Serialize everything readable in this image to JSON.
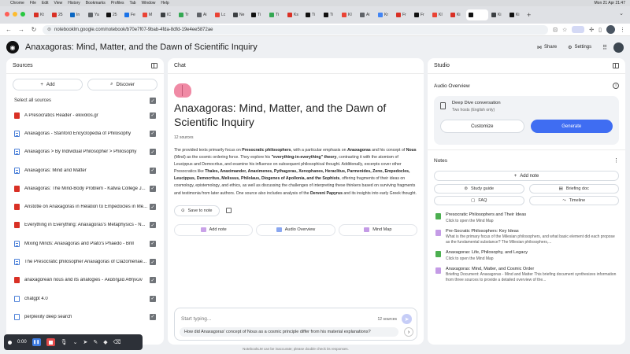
{
  "menubar": {
    "items": [
      "Chrome",
      "File",
      "Edit",
      "View",
      "History",
      "Bookmarks",
      "Profiles",
      "Tab",
      "Window",
      "Help"
    ],
    "clock": "Mon 21 Apr 21:47"
  },
  "tabs": [
    {
      "label": "Kt",
      "color": "#d93025"
    },
    {
      "label": "25",
      "color": "#d93025"
    },
    {
      "label": "In",
      "color": "#0a66c2"
    },
    {
      "label": "Ya",
      "color": "#5f6368"
    },
    {
      "label": "25",
      "color": "#111111"
    },
    {
      "label": "Fe",
      "color": "#1a73e8"
    },
    {
      "label": "M",
      "color": "#ea4335"
    },
    {
      "label": "IC",
      "color": "#3c4043"
    },
    {
      "label": "Tr",
      "color": "#34a853"
    },
    {
      "label": "Ai",
      "color": "#5f6368"
    },
    {
      "label": "Lc",
      "color": "#ea4335"
    },
    {
      "label": "Ne",
      "color": "#3c4043"
    },
    {
      "label": "Ti",
      "color": "#111111"
    },
    {
      "label": "Ti",
      "color": "#34a853"
    },
    {
      "label": "Ks",
      "color": "#d93025"
    },
    {
      "label": "Ti",
      "color": "#111111"
    },
    {
      "label": "Ti",
      "color": "#111111"
    },
    {
      "label": "KI",
      "color": "#ea4335"
    },
    {
      "label": "Ai",
      "color": "#5f6368"
    },
    {
      "label": "Kr",
      "color": "#4285f4"
    },
    {
      "label": "Fr",
      "color": "#d93025"
    },
    {
      "label": "Fr",
      "color": "#111111"
    },
    {
      "label": "KI",
      "color": "#ea4335"
    },
    {
      "label": "Ki",
      "color": "#d93025"
    },
    {
      "label": "",
      "color": "#111111",
      "active": true
    },
    {
      "label": "Ki",
      "color": "#3c4043"
    },
    {
      "label": "Ki",
      "color": "#111111"
    }
  ],
  "address": {
    "url": "notebooklm.google.com/notebook/b70e7f07-9bab-4fda-8dfd-19e4ee5872ae"
  },
  "header": {
    "title": "Anaxagoras: Mind, Matter, and the Dawn of Scientific Inquiry",
    "share": "Share",
    "settings": "Settings"
  },
  "sources": {
    "heading": "Sources",
    "add": "Add",
    "discover": "Discover",
    "select_all": "Select all sources",
    "items": [
      {
        "label": "A Presocratics Reader - ekivolos.gr",
        "type": "pdf"
      },
      {
        "label": "Anaxagoras - Stanford Encyclopedia of Philosophy",
        "type": "web"
      },
      {
        "label": "Anaxagoras > By Individual Philosopher > Philosophy",
        "type": "web"
      },
      {
        "label": "Anaxagoras: Mind and Matter",
        "type": "web"
      },
      {
        "label": "Anaxagoras: The Mind-Body Problem - Katwa College J...",
        "type": "pdf"
      },
      {
        "label": "Aristotle on Anaxagoras in Relation to Empedocles in Me...",
        "type": "pdf"
      },
      {
        "label": "Everything in Everything: Anaxagoras's Metaphysics - N...",
        "type": "pdf"
      },
      {
        "label": "Mixing Minds: Anaxagoras and Plato's Phaedo - Brill",
        "type": "web"
      },
      {
        "label": "The Presocratic philosopher Anaxagoras of Clazomenae...",
        "type": "web"
      },
      {
        "label": "anaxagorean nous and its analogies - Ακαδημία Αθηνών",
        "type": "pdf"
      },
      {
        "label": "chatgpt 4.0",
        "type": "txt"
      },
      {
        "label": "perplexity deep search",
        "type": "txt"
      }
    ]
  },
  "chat": {
    "heading": "Chat",
    "title": "Anaxagoras: Mind, Matter, and the Dawn of Scientific Inquiry",
    "count": "12 sources",
    "summary": {
      "t1": "The provided texts primarily focus on ",
      "b1": "Presocratic philosophers",
      "t2": ", with a particular emphasis on ",
      "b2": "Anaxagoras",
      "t3": " and his concept of ",
      "b3": "Nous",
      "t4": " (Mind) as the cosmic ordering force. They explore his ",
      "b4": "\"everything-in-everything\" theory",
      "t5": ", contrasting it with the atomism of Leucippus and Democritus, and examine his influence on subsequent philosophical thought. Additionally, excerpts cover other Presocratics like ",
      "b5": "Thales, Anaximander, Anaximenes, Pythagoras, Xenophanes, Heraclitus, Parmenides, Zeno, Empedocles, Leucippus, Democritus, Melissus, Philolaus, Diogenes of Apollonia, and the Sophists",
      "t6": ", offering fragments of their ideas on cosmology, epistemology, and ethics, as well as discussing the challenges of interpreting these thinkers based on surviving fragments and testimonia from later authors. One source also includes analysis of the ",
      "b6": "Derveni Papyrus",
      "t7": " and its insights into early Greek thought."
    },
    "save_note": "Save to note",
    "chips": [
      {
        "label": "Add note",
        "color": "#c9a2e8"
      },
      {
        "label": "Audio Overview",
        "color": "#8aa7f0"
      },
      {
        "label": "Mind Map",
        "color": "#c49be6"
      }
    ],
    "input_placeholder": "Start typing...",
    "input_count": "12 sources",
    "suggestion": "How did Anaxagoras' concept of Nous as a cosmic principle differ from his material explanations?"
  },
  "studio": {
    "heading": "Studio",
    "audio_overview": "Audio Overview",
    "deep_dive": "Deep Dive conversation",
    "hosts": "Two hosts (English only)",
    "customize": "Customize",
    "generate": "Generate",
    "notes": "Notes",
    "add_note": "Add note",
    "study_guide": "Study guide",
    "briefing_doc": "Briefing doc",
    "faq": "FAQ",
    "timeline": "Timeline",
    "note_items": [
      {
        "title": "Presocratic Philosophers and Their Ideas",
        "sub": "Click to open the Mind Map",
        "color": "#4caf50"
      },
      {
        "title": "Pre-Socratic Philosophers: Key Ideas",
        "sub": "What is the primary focus of the Milesian philosophers, and what basic element did each propose as the fundamental substance? The Milesian philosophers,...",
        "color": "#c49be6"
      },
      {
        "title": "Anaxagoras: Life, Philosophy, and Legacy",
        "sub": "Click to open the Mind Map",
        "color": "#4caf50"
      },
      {
        "title": "Anaxagoras: Mind, Matter, and Cosmic Order",
        "sub": "Briefing Document: Anaxagoras - Mind and Matter This briefing document synthesizes information from three sources to provide a detailed overview of the...",
        "color": "#c49be6"
      }
    ]
  },
  "footer": "NotebookLM can be inaccurate; please double check its responses.",
  "recorder": {
    "time": "0:00"
  }
}
